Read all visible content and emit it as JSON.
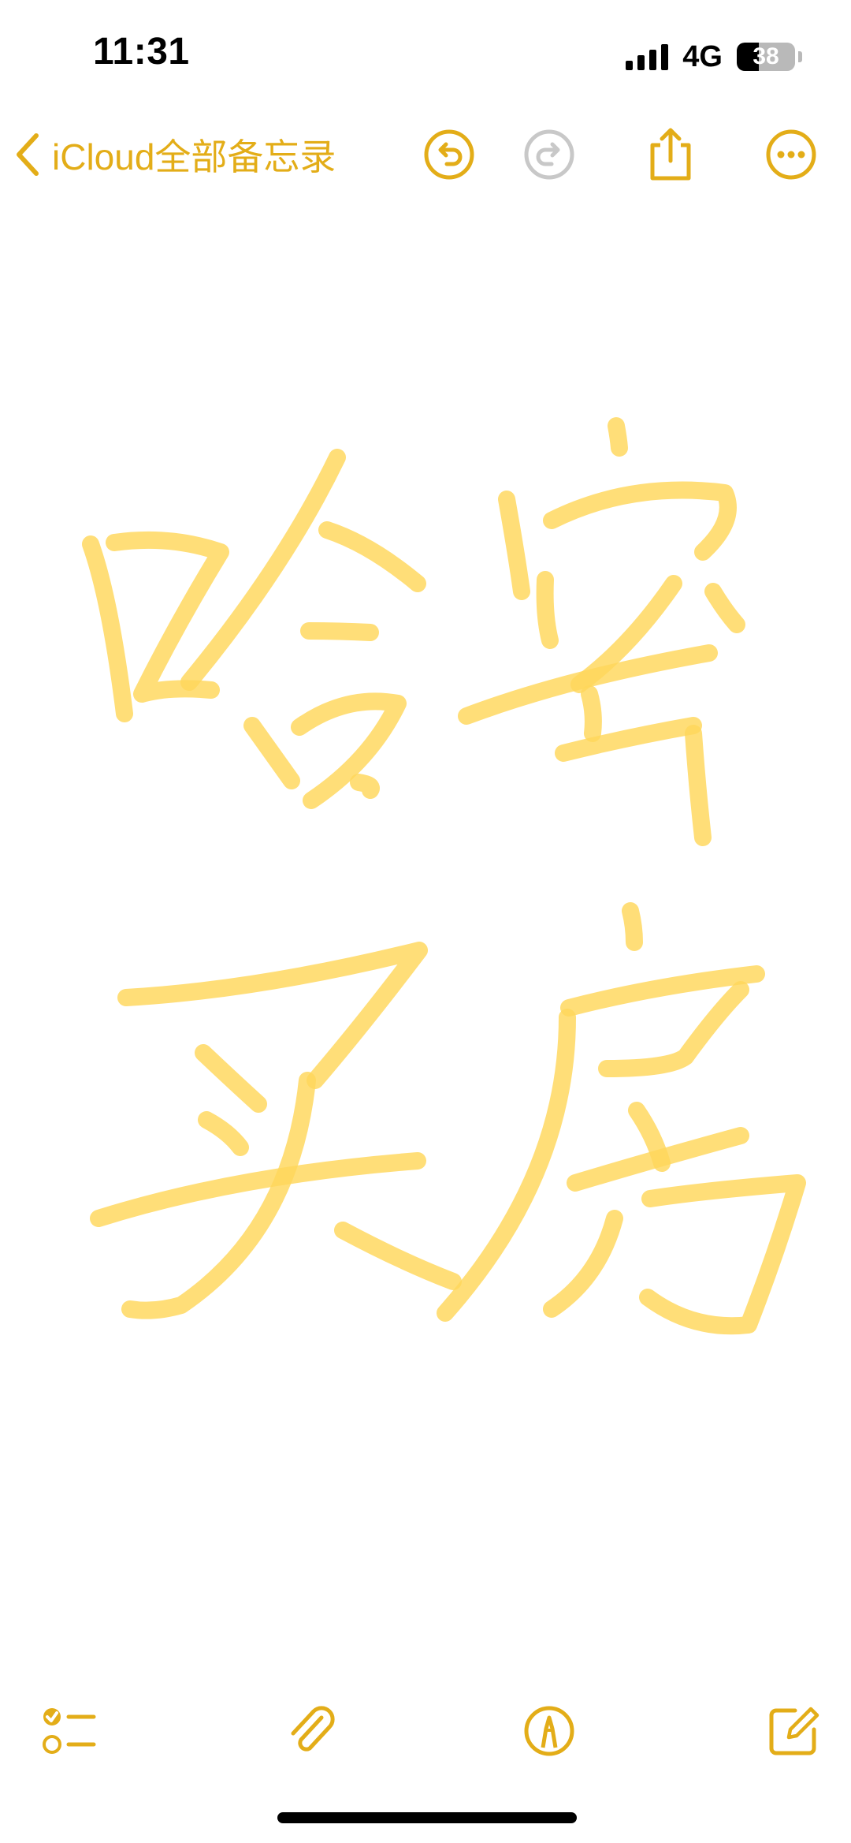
{
  "status_bar": {
    "time": "11:31",
    "network": "4G",
    "battery_percent": "38",
    "battery_level": 0.38,
    "signal_bars": 4
  },
  "nav": {
    "back_label": "iCloud全部备忘录",
    "icons": {
      "back": "chevron-left-icon",
      "undo": "undo-icon",
      "redo": "redo-icon",
      "share": "share-icon",
      "more": "more-icon"
    }
  },
  "toolbar": {
    "icons": {
      "checklist": "checklist-icon",
      "attachment": "paperclip-icon",
      "markup": "markup-pen-icon",
      "compose": "compose-icon"
    }
  },
  "colors": {
    "accent": "#e3ad18",
    "ink_highlight": "#ffd75a",
    "disabled": "#c8c8c8"
  }
}
